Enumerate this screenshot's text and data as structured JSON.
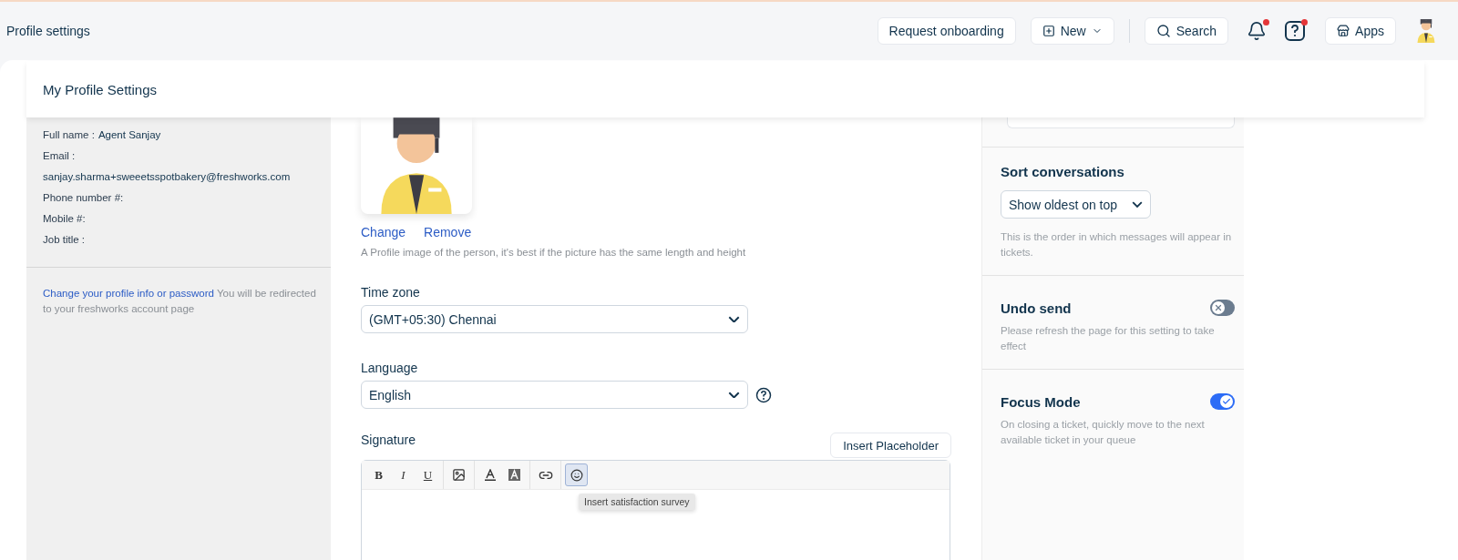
{
  "topbar": {
    "title": "Profile settings",
    "actions": [
      {
        "kind": "button",
        "label": "Request onboarding"
      },
      {
        "kind": "menu",
        "label": "New"
      },
      {
        "kind": "search",
        "label": "Search"
      },
      {
        "kind": "notifications",
        "unread": true
      },
      {
        "kind": "help",
        "unread": true
      },
      {
        "kind": "apps",
        "label": "Apps"
      }
    ]
  },
  "page_header": "My Profile Settings",
  "profile_info": [
    {
      "label": "Full name :",
      "value": "Agent Sanjay"
    },
    {
      "label": "Email :"
    },
    {
      "value": "sanjay.sharma+sweeetsspotbakery@freshworks.com"
    },
    {
      "label": "Phone number #:"
    },
    {
      "label": "Mobile #:"
    },
    {
      "label": "Job title :"
    }
  ],
  "account_note": {
    "link": "Change your profile info or password",
    "text": "You will be redirected to your freshworks account page"
  },
  "avatar": {
    "actions": [
      "Change",
      "Remove"
    ],
    "hint": "A Profile image of the person, it's best if the picture has the same length and height"
  },
  "fields": [
    {
      "label": "Time zone",
      "value": "(GMT+05:30) Chennai",
      "help": false
    },
    {
      "label": "Language",
      "value": "English",
      "help": true
    }
  ],
  "signature": {
    "label": "Signature",
    "insert_button": "Insert Placeholder",
    "toolbar": [
      [
        {
          "kind": "bold",
          "label": "B",
          "active": false
        },
        {
          "kind": "italic",
          "label": "I",
          "active": false
        },
        {
          "kind": "underline",
          "label": "U",
          "active": false
        }
      ],
      [
        {
          "kind": "image",
          "active": false
        }
      ],
      [
        {
          "kind": "font-color",
          "active": false
        },
        {
          "kind": "highlight",
          "active": false
        }
      ],
      [
        {
          "kind": "link",
          "active": false
        }
      ],
      [
        {
          "kind": "survey",
          "active": true
        }
      ]
    ],
    "tooltip": "Insert satisfaction survey"
  },
  "settings": [
    {
      "kind": "select",
      "title": "Sort conversations",
      "value": "Show oldest on top",
      "hint": "This is the order in which messages will appear in tickets."
    },
    {
      "kind": "toggle",
      "title": "Undo send",
      "on": false,
      "hint": "Please refresh the page for this setting to take effect"
    },
    {
      "kind": "toggle",
      "title": "Focus Mode",
      "on": true,
      "hint": "On closing a ticket, quickly move to the next available ticket in your queue"
    }
  ]
}
